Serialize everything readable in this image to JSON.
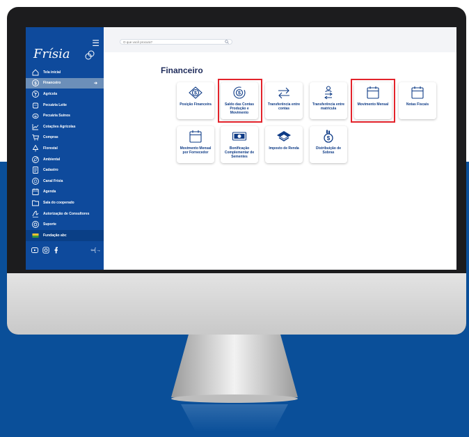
{
  "sidebar": {
    "brand": "Frísia",
    "items": [
      {
        "label": "Tela inicial",
        "icon": "home-icon"
      },
      {
        "label": "Financeiro",
        "icon": "money-icon",
        "active": true
      },
      {
        "label": "Agrícola",
        "icon": "agriculture-icon"
      },
      {
        "label": "Pecuária Leite",
        "icon": "milk-icon"
      },
      {
        "label": "Pecuária Suínos",
        "icon": "pig-icon"
      },
      {
        "label": "Cotações Agrícolas",
        "icon": "chart-icon"
      },
      {
        "label": "Compras",
        "icon": "cart-icon"
      },
      {
        "label": "Florestal",
        "icon": "tree-icon"
      },
      {
        "label": "Ambiental",
        "icon": "leaf-icon"
      },
      {
        "label": "Cadastro",
        "icon": "document-icon"
      },
      {
        "label": "Canal Frísia",
        "icon": "channel-icon"
      },
      {
        "label": "Agenda",
        "icon": "calendar-icon"
      },
      {
        "label": "Sala do cooperado",
        "icon": "folder-icon"
      },
      {
        "label": "Autorização de Consultores",
        "icon": "signature-icon"
      },
      {
        "label": "Suporte",
        "icon": "support-icon"
      },
      {
        "label": "Fundação abc",
        "icon": "partner-logo-icon"
      }
    ],
    "socials": [
      "youtube-icon",
      "instagram-icon",
      "facebook-icon"
    ],
    "logout_label": "⇦[→"
  },
  "search": {
    "placeholder": "O que você procura?"
  },
  "page": {
    "title": "Financeiro"
  },
  "cards": [
    {
      "label": "Posição Financeira",
      "icon": "money-position-icon",
      "highlighted": false
    },
    {
      "label": "Saldo das Contas Produção e Movimento",
      "icon": "money-refresh-icon",
      "highlighted": true
    },
    {
      "label": "Transferência entre contas",
      "icon": "transfer-arrows-icon",
      "highlighted": false
    },
    {
      "label": "Transferência entre matrícula",
      "icon": "user-transfer-icon",
      "highlighted": false
    },
    {
      "label": "Movimento Mensal",
      "icon": "calendar-icon",
      "highlighted": true
    },
    {
      "label": "Notas Fiscais",
      "icon": "calendar-icon",
      "highlighted": false
    },
    {
      "label": "Movimento Mensal por Fornecedor",
      "icon": "calendar-icon",
      "highlighted": false
    },
    {
      "label": "Bonificação Complementar de Sementes",
      "icon": "banknote-icon",
      "highlighted": false
    },
    {
      "label": "Imposto de Renda",
      "icon": "tax-icon",
      "highlighted": false
    },
    {
      "label": "Distribuição de Sobras",
      "icon": "money-bag-icon",
      "highlighted": false
    }
  ],
  "colors": {
    "sidebar": "#0e4a9c",
    "active_item": "#6c8fb9",
    "card_text": "#0e3b86",
    "highlight": "#e3232b",
    "background_blue": "#0a4f99"
  }
}
